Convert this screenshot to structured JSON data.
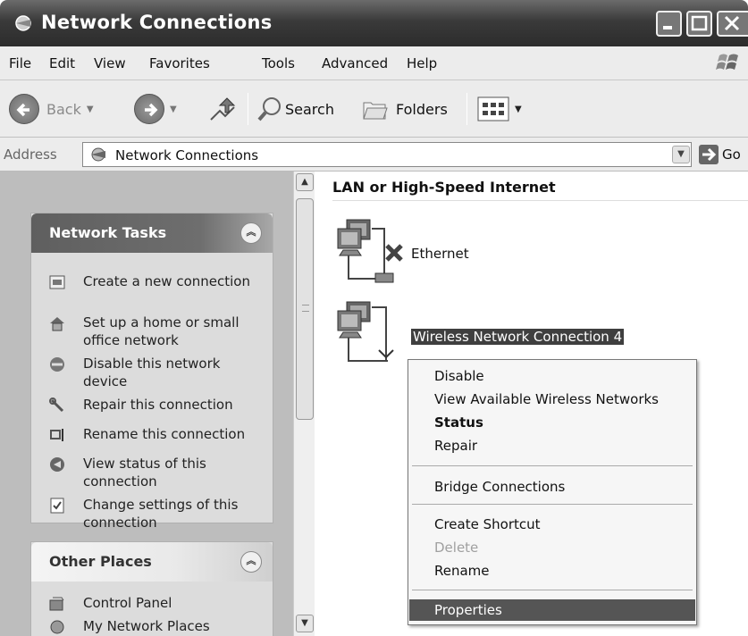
{
  "window": {
    "title": "Network Connections",
    "title_icon": "network-connections-icon"
  },
  "menu": [
    "File",
    "Edit",
    "View",
    "Favorites",
    "Tools",
    "Advanced",
    "Help"
  ],
  "toolbar": {
    "back": "Back",
    "search": "Search",
    "folders": "Folders"
  },
  "address": {
    "label": "Address",
    "value": "Network Connections",
    "go": "Go"
  },
  "network_tasks": {
    "title": "Network Tasks",
    "items": [
      {
        "label": "Create a new connection",
        "icon": "new-connection-icon"
      },
      {
        "label": "Set up a home or small office network",
        "icon": "home-network-icon"
      },
      {
        "label": "Disable this network device",
        "icon": "disable-icon"
      },
      {
        "label": "Repair this connection",
        "icon": "repair-icon"
      },
      {
        "label": "Rename this connection",
        "icon": "rename-icon"
      },
      {
        "label": "View status of this connection",
        "icon": "status-icon"
      },
      {
        "label": "Change settings of this connection",
        "icon": "settings-icon"
      }
    ]
  },
  "other_places": {
    "title": "Other Places",
    "items": [
      {
        "label": "Control Panel",
        "icon": "control-panel-icon"
      },
      {
        "label": "My Network Places",
        "icon": "network-places-icon"
      }
    ]
  },
  "main": {
    "group_header": "LAN or High-Speed Internet",
    "connections": [
      {
        "label": "Ethernet",
        "status": "disconnected"
      },
      {
        "label": "Wireless Network Connection 4",
        "selected": true
      }
    ]
  },
  "context_menu": {
    "items": [
      {
        "label": "Disable"
      },
      {
        "label": "View Available Wireless Networks"
      },
      {
        "label": "Status",
        "bold": true
      },
      {
        "label": "Repair"
      },
      {
        "label": "Bridge Connections"
      },
      {
        "label": "Create Shortcut"
      },
      {
        "label": "Delete",
        "disabled": true
      },
      {
        "label": "Rename"
      },
      {
        "label": "Properties",
        "highlighted": true
      }
    ]
  }
}
